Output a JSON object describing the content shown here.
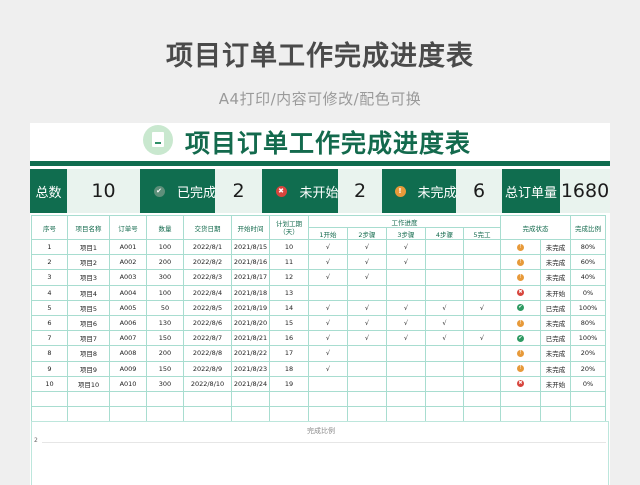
{
  "header": {
    "title": "项目订单工作完成进度表",
    "subtitle": "A4打印/内容可修改/配色可换"
  },
  "sheet": {
    "title": "项目订单工作完成进度表",
    "accent": "#106d4f"
  },
  "stats": {
    "total_label": "总数",
    "total_value": "10",
    "done_label": "已完成",
    "done_value": "2",
    "notstarted_label": "未开始",
    "notstarted_value": "2",
    "undone_label": "未完成",
    "undone_value": "6",
    "orders_label": "总订单量",
    "orders_value": "1680"
  },
  "table": {
    "headers": {
      "seq": "序号",
      "name": "项目名称",
      "order": "订单号",
      "qty": "数量",
      "delivery": "交货日期",
      "start": "开始时间",
      "plan": "计划工期（天）",
      "progress": "工作进度",
      "steps": [
        "1开始",
        "2步骤",
        "3步骤",
        "4步骤",
        "5完工"
      ],
      "status": "完成状态",
      "ratio": "完成比例"
    },
    "rows": [
      {
        "seq": "1",
        "name": "项目1",
        "order": "A001",
        "qty": "100",
        "delivery": "2022/8/1",
        "start": "2021/8/15",
        "plan": "10",
        "steps": [
          "√",
          "√",
          "√",
          "",
          ""
        ],
        "status": "未完成",
        "status_type": "partial",
        "ratio": "80%"
      },
      {
        "seq": "2",
        "name": "项目2",
        "order": "A002",
        "qty": "200",
        "delivery": "2022/8/2",
        "start": "2021/8/16",
        "plan": "11",
        "steps": [
          "√",
          "√",
          "√",
          "",
          ""
        ],
        "status": "未完成",
        "status_type": "partial",
        "ratio": "60%"
      },
      {
        "seq": "3",
        "name": "项目3",
        "order": "A003",
        "qty": "300",
        "delivery": "2022/8/3",
        "start": "2021/8/17",
        "plan": "12",
        "steps": [
          "√",
          "√",
          "",
          "",
          ""
        ],
        "status": "未完成",
        "status_type": "partial",
        "ratio": "40%"
      },
      {
        "seq": "4",
        "name": "项目4",
        "order": "A004",
        "qty": "100",
        "delivery": "2022/8/4",
        "start": "2021/8/18",
        "plan": "13",
        "steps": [
          "",
          "",
          "",
          "",
          ""
        ],
        "status": "未开始",
        "status_type": "none",
        "ratio": "0%"
      },
      {
        "seq": "5",
        "name": "项目5",
        "order": "A005",
        "qty": "50",
        "delivery": "2022/8/5",
        "start": "2021/8/19",
        "plan": "14",
        "steps": [
          "√",
          "√",
          "√",
          "√",
          "√"
        ],
        "status": "已完成",
        "status_type": "done",
        "ratio": "100%"
      },
      {
        "seq": "6",
        "name": "项目6",
        "order": "A006",
        "qty": "130",
        "delivery": "2022/8/6",
        "start": "2021/8/20",
        "plan": "15",
        "steps": [
          "√",
          "√",
          "√",
          "√",
          ""
        ],
        "status": "未完成",
        "status_type": "partial",
        "ratio": "80%"
      },
      {
        "seq": "7",
        "name": "项目7",
        "order": "A007",
        "qty": "150",
        "delivery": "2022/8/7",
        "start": "2021/8/21",
        "plan": "16",
        "steps": [
          "√",
          "√",
          "√",
          "√",
          "√"
        ],
        "status": "已完成",
        "status_type": "done",
        "ratio": "100%"
      },
      {
        "seq": "8",
        "name": "项目8",
        "order": "A008",
        "qty": "200",
        "delivery": "2022/8/8",
        "start": "2021/8/22",
        "plan": "17",
        "steps": [
          "√",
          "",
          "",
          "",
          ""
        ],
        "status": "未完成",
        "status_type": "partial",
        "ratio": "20%"
      },
      {
        "seq": "9",
        "name": "项目9",
        "order": "A009",
        "qty": "150",
        "delivery": "2022/8/9",
        "start": "2021/8/23",
        "plan": "18",
        "steps": [
          "√",
          "",
          "",
          "",
          ""
        ],
        "status": "未完成",
        "status_type": "partial",
        "ratio": "20%"
      },
      {
        "seq": "10",
        "name": "项目10",
        "order": "A010",
        "qty": "300",
        "delivery": "2022/8/10",
        "start": "2021/8/24",
        "plan": "19",
        "steps": [
          "",
          "",
          "",
          "",
          ""
        ],
        "status": "未开始",
        "status_type": "none",
        "ratio": "0%"
      }
    ]
  },
  "chart": {
    "title": "完成比例",
    "y_tick": "2"
  },
  "colors": {
    "done": "#2e9a62",
    "partial": "#e79a3a",
    "none": "#d7453d"
  }
}
